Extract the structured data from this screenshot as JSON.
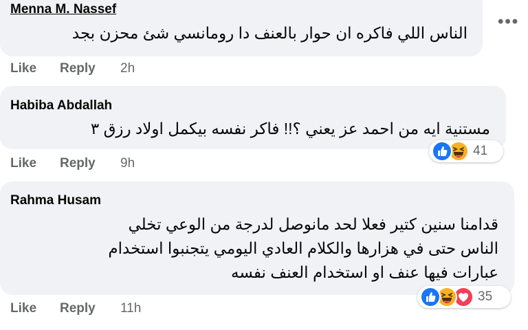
{
  "more_menu": "•••",
  "comments": [
    {
      "author": "Menna M. Nassef",
      "lines": [
        "الناس اللي فاكره ان حوار بالعنف دا رومانسي شئ محزن بجد"
      ],
      "actions": {
        "like": "Like",
        "reply": "Reply",
        "time": "2h"
      },
      "reactions": null
    },
    {
      "author": "Habiba Abdallah",
      "lines": [
        "مستنية ايه من احمد عز يعني ؟!! فاكر نفسه بيكمل اولاد رزق ٣"
      ],
      "actions": {
        "like": "Like",
        "reply": "Reply",
        "time": "9h"
      },
      "reactions": {
        "icons": [
          "like-icon",
          "haha-icon"
        ],
        "count": "41"
      }
    },
    {
      "author": "Rahma Husam",
      "lines": [
        "قدامنا سنين كتير فعلا لحد مانوصل لدرجة من الوعي تخلي",
        "الناس حتى في هزارها والكلام العادي اليومي يتجنبوا استخدام",
        "عبارات فيها عنف او استخدام العنف نفسه"
      ],
      "actions": {
        "like": "Like",
        "reply": "Reply",
        "time": "11h"
      },
      "reactions": {
        "icons": [
          "like-icon",
          "haha-icon",
          "love-icon"
        ],
        "count": "35"
      }
    }
  ],
  "colors": {
    "bubble": "#f0f2f5",
    "muted": "#65676b",
    "like_blue": "#1877f2",
    "haha_yellow": "#f7b125",
    "love_red": "#f33e58"
  }
}
